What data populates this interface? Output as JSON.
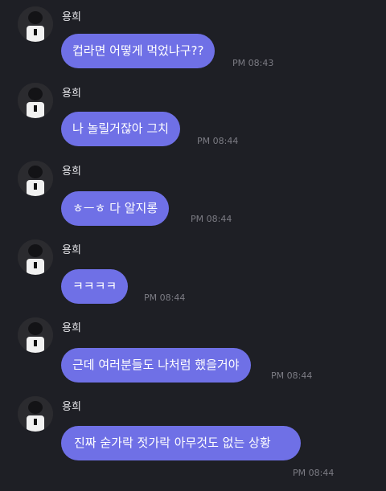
{
  "chat": {
    "messages": [
      {
        "sender": "용희",
        "text": "컵라면 어떻게 먹었냐구??",
        "time": "PM 08:43"
      },
      {
        "sender": "용희",
        "text": "나 놀릴거잖아 그치",
        "time": "PM 08:44"
      },
      {
        "sender": "용희",
        "text": "ㅎㅡㅎ 다 알지롱",
        "time": "PM 08:44"
      },
      {
        "sender": "용희",
        "text": "ㅋㅋㅋㅋ",
        "time": "PM 08:44"
      },
      {
        "sender": "용희",
        "text": "근데 여러분들도 나처럼 했을거야",
        "time": "PM 08:44"
      },
      {
        "sender": "용희",
        "text": "진짜 숟가락 젓가락 아무것도 없는 상황",
        "time": "PM 08:44"
      }
    ]
  },
  "colors": {
    "background": "#1e1f25",
    "bubble": "#6f70e6",
    "bubble_text": "#ffffff",
    "timestamp": "#7c7c84"
  }
}
